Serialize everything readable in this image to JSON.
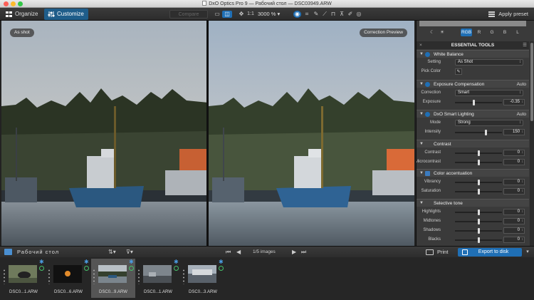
{
  "window": {
    "title": "DxO Optics Pro 9 — Рабочий стол — DSC03949.ARW"
  },
  "toolbar": {
    "organize_label": "Organize",
    "customize_label": "Customize",
    "compare_label": "Compare",
    "zoom_1to1": "1:1",
    "zoom_value": "3000 %",
    "apply_preset_label": "Apply preset"
  },
  "viewer": {
    "left_label": "As shot",
    "right_label": "Correction Preview"
  },
  "panel": {
    "channels": [
      "RGB",
      "R",
      "G",
      "B",
      "L"
    ],
    "essential_title": "ESSENTIAL TOOLS",
    "white_balance": {
      "title": "White Balance",
      "setting_label": "Setting",
      "setting_value": "As Shot",
      "pick_color_label": "Pick Color"
    },
    "exposure": {
      "title": "Exposure Compensation",
      "auto": "Auto",
      "correction_label": "Correction",
      "correction_value": "Smart",
      "exposure_label": "Exposure",
      "exposure_value": "-0.35"
    },
    "smart_lighting": {
      "title": "DxO Smart Lighting",
      "auto": "Auto",
      "mode_label": "Mode",
      "mode_value": "Strong",
      "intensity_label": "Intensity",
      "intensity_value": "150"
    },
    "contrast": {
      "title": "Contrast",
      "contrast_label": "Contrast",
      "contrast_value": "0",
      "micro_label": "Microcontrast",
      "micro_value": "0"
    },
    "color_accentuation": {
      "title": "Color accentuation",
      "vibrancy_label": "Vibrancy",
      "vibrancy_value": "0",
      "saturation_label": "Saturation",
      "saturation_value": "0"
    },
    "selective_tone": {
      "title": "Selective tone",
      "highlights_label": "Highlights",
      "highlights_value": "0",
      "midtones_label": "Midtones",
      "midtones_value": "0",
      "shadows_label": "Shadows",
      "shadows_value": "0",
      "blacks_label": "Blacks",
      "blacks_value": "0"
    }
  },
  "bottombar": {
    "folder_name": "Рабочий стол",
    "images_count": "1/5 images",
    "print_label": "Print",
    "export_label": "Export to disk"
  },
  "filmstrip": [
    {
      "name": "DSC0...1.ARW"
    },
    {
      "name": "DSC0...6.ARW"
    },
    {
      "name": "DSC0...9.ARW"
    },
    {
      "name": "DSC0...1.ARW"
    },
    {
      "name": "DSC0...3.ARW"
    }
  ],
  "colors": {
    "accent": "#1f6fb5",
    "selected_tab": "#1f5d8a",
    "ok_green": "#46c06a"
  }
}
